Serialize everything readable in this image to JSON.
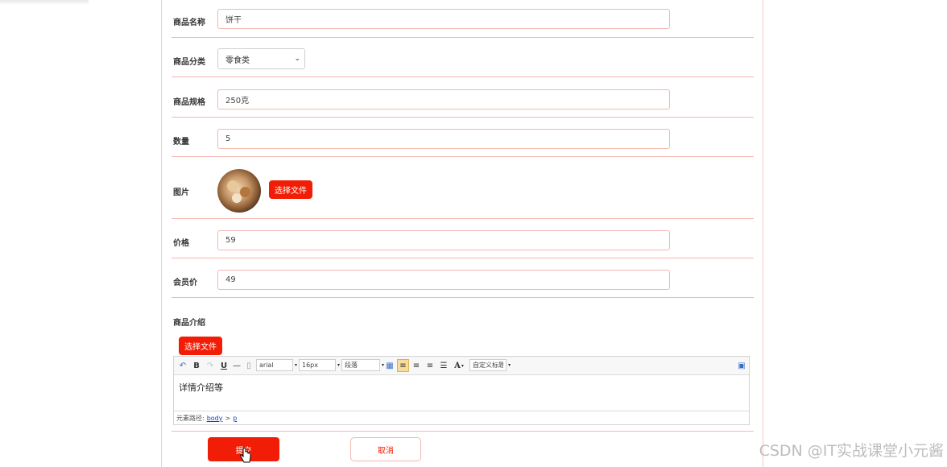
{
  "form": {
    "name": {
      "label": "商品名称",
      "value": "饼干"
    },
    "category": {
      "label": "商品分类",
      "value": "零食类"
    },
    "spec": {
      "label": "商品规格",
      "value": "250克"
    },
    "quantity": {
      "label": "数量",
      "value": "5"
    },
    "image": {
      "label": "图片",
      "choose_file": "选择文件"
    },
    "price": {
      "label": "价格",
      "value": "59"
    },
    "member_price": {
      "label": "会员价",
      "value": "49"
    },
    "intro": {
      "label": "商品介绍",
      "choose_file": "选择文件"
    }
  },
  "editor": {
    "toolbar": {
      "bold": "B",
      "underline": "U",
      "font_family": "arial",
      "font_size": "16px",
      "paragraph": "段落",
      "font_color": "A",
      "custom_title": "自定义标题"
    },
    "content": "详情介绍等",
    "path_label": "元素路径:",
    "path_links": [
      "body",
      "p"
    ],
    "path_sep": ">"
  },
  "actions": {
    "submit": "提交",
    "cancel": "取消"
  },
  "watermark": "CSDN @IT实战课堂小元酱",
  "colors": {
    "accent": "#f21d06",
    "border": "#f3b7b0"
  },
  "icons": [
    "undo-icon",
    "redo-icon",
    "horizontal-rule-icon",
    "clear-format-icon",
    "table-icon",
    "align-left-icon",
    "align-right-icon",
    "align-center-icon",
    "justify-icon",
    "fullscreen-icon",
    "cursor-hand-icon"
  ]
}
